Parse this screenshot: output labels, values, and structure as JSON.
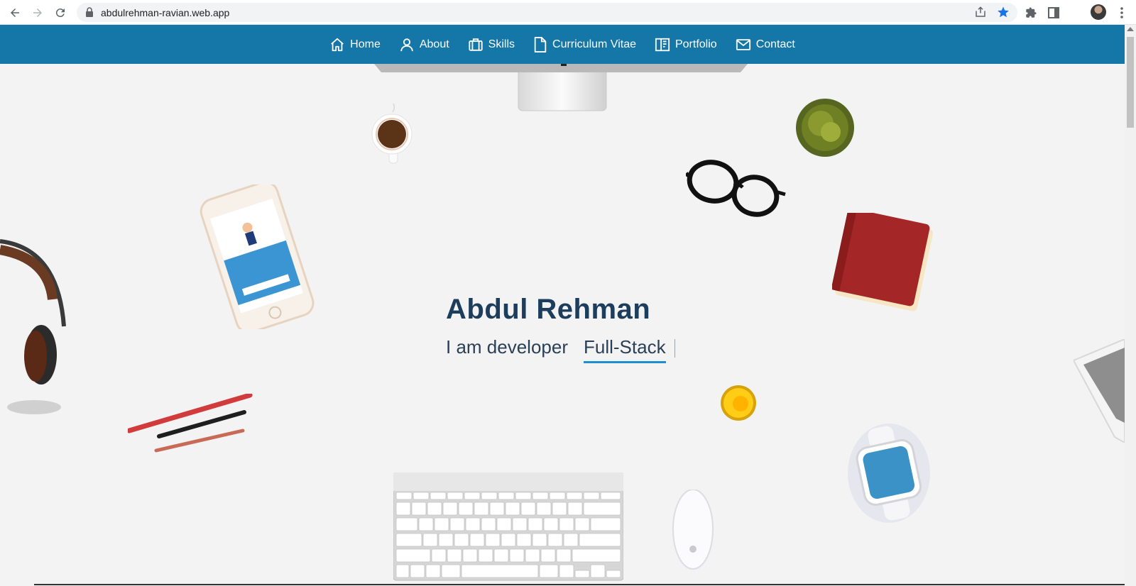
{
  "browser": {
    "url": "abdulrehman-ravian.web.app"
  },
  "nav": {
    "items": [
      {
        "label": "Home",
        "icon": "home-icon"
      },
      {
        "label": "About",
        "icon": "user-icon"
      },
      {
        "label": "Skills",
        "icon": "briefcase-icon"
      },
      {
        "label": "Curriculum Vitae",
        "icon": "document-icon"
      },
      {
        "label": "Portfolio",
        "icon": "portfolio-icon"
      },
      {
        "label": "Contact",
        "icon": "mail-icon"
      }
    ]
  },
  "hero": {
    "name": "Abdul Rehman",
    "intro": "I am developer",
    "role": "Full-Stack"
  },
  "colors": {
    "navbar": "#1477a8",
    "heading": "#1d3d5c",
    "underline": "#1f8fcf",
    "background": "#f3f3f3"
  }
}
